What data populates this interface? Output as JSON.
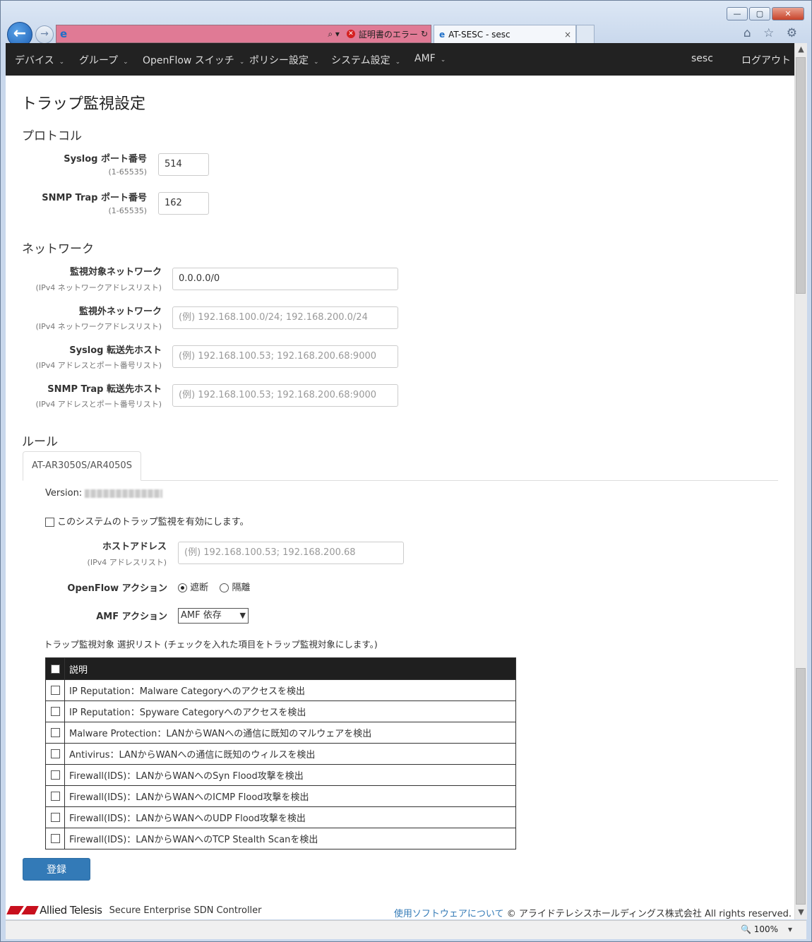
{
  "browser": {
    "back": "←",
    "forward": "→",
    "address_tools": "⌕ ▾",
    "cert_error": "証明書のエラー",
    "refresh": "↻",
    "tab_title": "AT-SESC - sesc",
    "tab_close": "×",
    "win_min": "—",
    "win_max": "▢",
    "win_close": "✕",
    "toolbar_icons": "⌂ ☆ ⚙",
    "zoom": "🔍 100%",
    "zoom_arrow": "▾"
  },
  "navbar": {
    "items": [
      "デバイス",
      "グループ",
      "OpenFlow スイッチ",
      "ポリシー設定",
      "システム設定",
      "AMF"
    ],
    "user": "sesc",
    "logout": "ログアウト"
  },
  "page_title": "トラップ監視設定",
  "protocol": {
    "heading": "プロトコル",
    "syslog_label": "Syslog ポート番号",
    "syslog_hint": "(1-65535)",
    "syslog_value": "514",
    "snmp_label": "SNMP Trap ポート番号",
    "snmp_hint": "(1-65535)",
    "snmp_value": "162"
  },
  "network": {
    "heading": "ネットワーク",
    "monitor_label": "監視対象ネットワーク",
    "monitor_hint": "(IPv4 ネットワークアドレスリスト)",
    "monitor_value": "0.0.0.0/0",
    "exclude_label": "監視外ネットワーク",
    "exclude_hint": "(IPv4 ネットワークアドレスリスト)",
    "exclude_placeholder": "(例) 192.168.100.0/24; 192.168.200.0/24",
    "syslog_fwd_label": "Syslog 転送先ホスト",
    "syslog_fwd_hint": "(IPv4 アドレスとポート番号リスト)",
    "syslog_fwd_placeholder": "(例) 192.168.100.53; 192.168.200.68:9000",
    "snmp_fwd_label": "SNMP Trap 転送先ホスト",
    "snmp_fwd_hint": "(IPv4 アドレスとポート番号リスト)",
    "snmp_fwd_placeholder": "(例) 192.168.100.53; 192.168.200.68:9000"
  },
  "rules": {
    "heading": "ルール",
    "tab": "AT-AR3050S/AR4050S",
    "version_label": "Version:",
    "enable_label": "このシステムのトラップ監視を有効にします。",
    "host_label": "ホストアドレス",
    "host_hint": "(IPv4 アドレスリスト)",
    "host_placeholder": "(例) 192.168.100.53; 192.168.200.68",
    "openflow_label": "OpenFlow アクション",
    "openflow_options": [
      "遮断",
      "隔離"
    ],
    "amf_label": "AMF アクション",
    "amf_selected": "AMF 依存",
    "list_caption": "トラップ監視対象 選択リスト (チェックを入れた項目をトラップ監視対象にします。)",
    "table_header": "説明",
    "table_rows": [
      "IP Reputation：Malware Categoryへのアクセスを検出",
      "IP Reputation：Spyware Categoryへのアクセスを検出",
      "Malware Protection：LANからWANへの通信に既知のマルウェアを検出",
      "Antivirus：LANからWANへの通信に既知のウィルスを検出",
      "Firewall(IDS)：LANからWANへのSyn Flood攻撃を検出",
      "Firewall(IDS)：LANからWANへのICMP Flood攻撃を検出",
      "Firewall(IDS)：LANからWANへのUDP Flood攻撃を検出",
      "Firewall(IDS)：LANからWANへのTCP Stealth Scanを検出"
    ]
  },
  "submit_label": "登録",
  "footer": {
    "brand": "Allied Telesis",
    "product": "Secure Enterprise SDN Controller",
    "software_link": "使用ソフトウェアについて",
    "copyright": "© アライドテレシスホールディングス株式会社 All rights reserved."
  }
}
